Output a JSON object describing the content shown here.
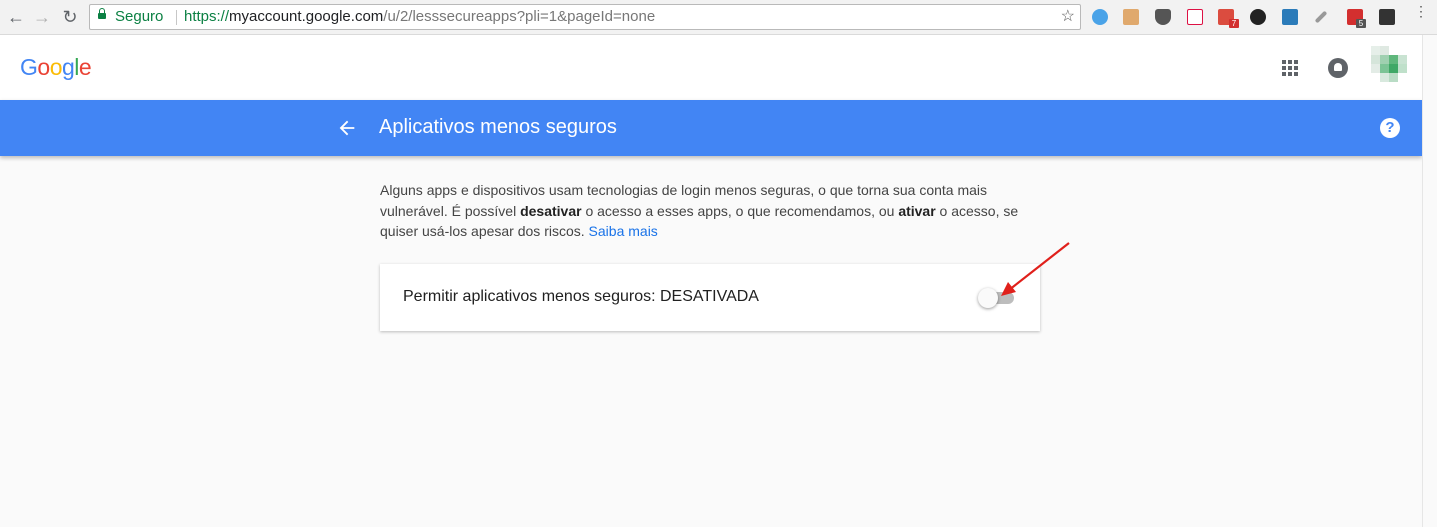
{
  "browser": {
    "security_label": "Seguro",
    "url_scheme": "https://",
    "url_domain": "myaccount.google.com",
    "url_path": "/u/2/lesssecureapps?pli=1&pageId=none",
    "extension_badges": [
      "7",
      "5"
    ]
  },
  "header": {
    "logo_letters": [
      {
        "char": "G",
        "color": "#4285f4"
      },
      {
        "char": "o",
        "color": "#ea4335"
      },
      {
        "char": "o",
        "color": "#fbbc05"
      },
      {
        "char": "g",
        "color": "#4285f4"
      },
      {
        "char": "l",
        "color": "#34a853"
      },
      {
        "char": "e",
        "color": "#ea4335"
      }
    ]
  },
  "page": {
    "title": "Aplicativos menos seguros",
    "accent_color": "#4285f4",
    "description": {
      "part1": "Alguns apps e dispositivos usam tecnologias de login menos seguras, o que torna sua conta mais vulnerável. É possível ",
      "bold1": "desativar",
      "part2": " o acesso a esses apps, o que recomendamos, ou ",
      "bold2": "ativar",
      "part3": " o acesso, se quiser usá-los apesar dos riscos. ",
      "link": "Saiba mais"
    },
    "setting": {
      "label": "Permitir aplicativos menos seguros: DESATIVADA",
      "enabled": false
    }
  }
}
